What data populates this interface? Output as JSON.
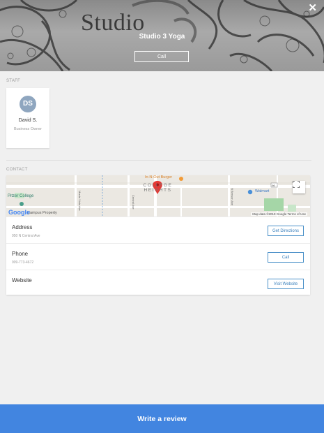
{
  "hero": {
    "brand_text": "Studio",
    "title": "Studio 3 Yoga",
    "call_label": "Call",
    "close_symbol": "✕"
  },
  "staff": {
    "section_label": "STAFF",
    "members": [
      {
        "initials": "DS",
        "name": "David S.",
        "role": "Business Owner",
        "avatar_color": "#8fa6bf"
      }
    ]
  },
  "contact": {
    "section_label": "CONTACT",
    "map": {
      "labels": {
        "in_n_out": "In-N-Out Burger",
        "college_heights": "COLLEGE HEIGHTS",
        "walmart": "Walmart",
        "pitzer": "Pitzer College",
        "campus": "Campus Property",
        "monte_vista": "Monte Vista Ave",
        "central": "Central Ave",
        "benson": "N Benson Ave",
        "route_shield": "66"
      },
      "logo": "Google",
      "attribution": "Map data ©2019 Google   Terms of Use"
    },
    "rows": [
      {
        "title": "Address",
        "subtitle": "950 N Central Ave",
        "button": "Get Directions"
      },
      {
        "title": "Phone",
        "subtitle": "909-773-4672",
        "button": "Call"
      },
      {
        "title": "Website",
        "subtitle": "",
        "button": "Visit Website"
      }
    ]
  },
  "footer": {
    "review_label": "Write a review"
  },
  "colors": {
    "accent": "#4285e0",
    "button_border": "#4a90c8",
    "map_pin": "#e53935"
  }
}
